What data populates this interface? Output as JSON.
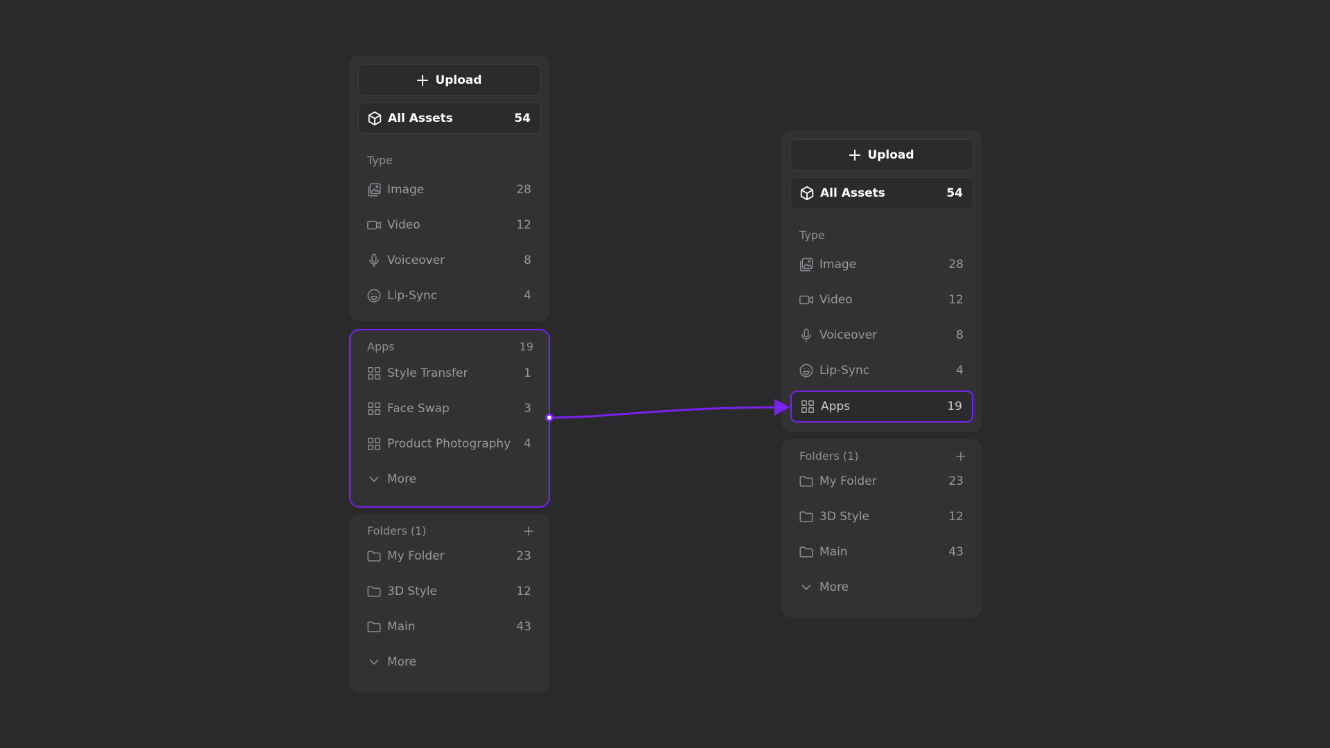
{
  "left_panel": {
    "upload_label": "Upload",
    "all_assets": {
      "label": "All Assets",
      "count": "54"
    },
    "type_section": {
      "title": "Type",
      "items": [
        {
          "label": "Image",
          "count": "28",
          "icon": "image-icon"
        },
        {
          "label": "Video",
          "count": "12",
          "icon": "video-icon"
        },
        {
          "label": "Voiceover",
          "count": "8",
          "icon": "microphone-icon"
        },
        {
          "label": "Lip-Sync",
          "count": "4",
          "icon": "smiley-icon"
        }
      ]
    },
    "apps_section": {
      "title": "Apps",
      "count": "19",
      "items": [
        {
          "label": "Style Transfer",
          "count": "1",
          "icon": "grid-icon"
        },
        {
          "label": "Face Swap",
          "count": "3",
          "icon": "grid-icon"
        },
        {
          "label": "Product Photography",
          "count": "4",
          "icon": "grid-icon"
        }
      ],
      "more_label": "More"
    },
    "folders_section": {
      "title": "Folders (1)",
      "items": [
        {
          "label": "My Folder",
          "count": "23",
          "icon": "folder-icon"
        },
        {
          "label": "3D Style",
          "count": "12",
          "icon": "folder-icon"
        },
        {
          "label": "Main",
          "count": "43",
          "icon": "folder-icon"
        }
      ],
      "more_label": "More"
    }
  },
  "right_panel": {
    "upload_label": "Upload",
    "all_assets": {
      "label": "All Assets",
      "count": "54"
    },
    "type_section": {
      "title": "Type",
      "items": [
        {
          "label": "Image",
          "count": "28",
          "icon": "image-icon"
        },
        {
          "label": "Video",
          "count": "12",
          "icon": "video-icon"
        },
        {
          "label": "Voiceover",
          "count": "8",
          "icon": "microphone-icon"
        },
        {
          "label": "Lip-Sync",
          "count": "4",
          "icon": "smiley-icon"
        }
      ],
      "apps_item": {
        "label": "Apps",
        "count": "19",
        "icon": "grid-icon"
      }
    },
    "folders_section": {
      "title": "Folders (1)",
      "items": [
        {
          "label": "My Folder",
          "count": "23",
          "icon": "folder-icon"
        },
        {
          "label": "3D Style",
          "count": "12",
          "icon": "folder-icon"
        },
        {
          "label": "Main",
          "count": "43",
          "icon": "folder-icon"
        }
      ],
      "more_label": "More"
    }
  },
  "colors": {
    "background": "#2a2a2c",
    "panel": "#323234",
    "accent": "#7a22f0",
    "text_primary": "#ffffff",
    "text_muted": "#9a9a9e"
  }
}
